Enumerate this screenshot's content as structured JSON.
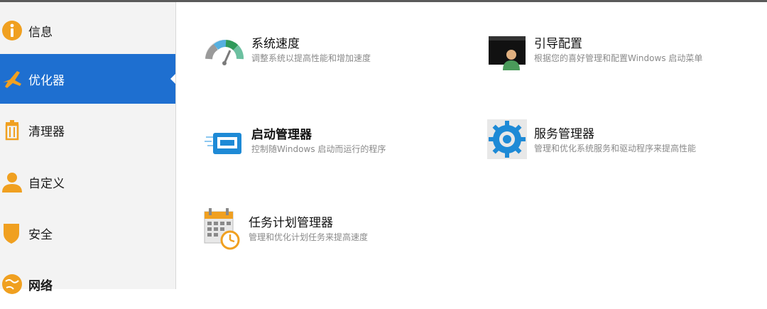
{
  "sidebar": {
    "items": [
      {
        "label": "信息",
        "icon": "info-icon"
      },
      {
        "label": "优化器",
        "icon": "airplane-icon",
        "active": true
      },
      {
        "label": "清理器",
        "icon": "trash-icon"
      },
      {
        "label": "自定义",
        "icon": "user-icon"
      },
      {
        "label": "安全",
        "icon": "shield-icon"
      },
      {
        "label": "网络",
        "icon": "globe-icon"
      }
    ]
  },
  "tools": [
    {
      "title": "系统速度",
      "desc": "调整系统以提高性能和增加速度",
      "icon": "speedometer-icon"
    },
    {
      "title": "引导配置",
      "desc": "根据您的喜好管理和配置Windows 启动菜单",
      "icon": "boot-config-icon"
    },
    {
      "title": "启动管理器",
      "desc": "控制随Windows 启动而运行的程序",
      "icon": "startup-window-icon"
    },
    {
      "title": "服务管理器",
      "desc": "管理和优化系统服务和驱动程序来提高性能",
      "icon": "gear-icon"
    },
    {
      "title": "任务计划管理器",
      "desc": "管理和优化计划任务来提高速度",
      "icon": "calendar-clock-icon"
    }
  ],
  "colors": {
    "accent": "#1e6fd0",
    "icon_orange": "#f0a020",
    "icon_blue": "#1e8ad6"
  }
}
